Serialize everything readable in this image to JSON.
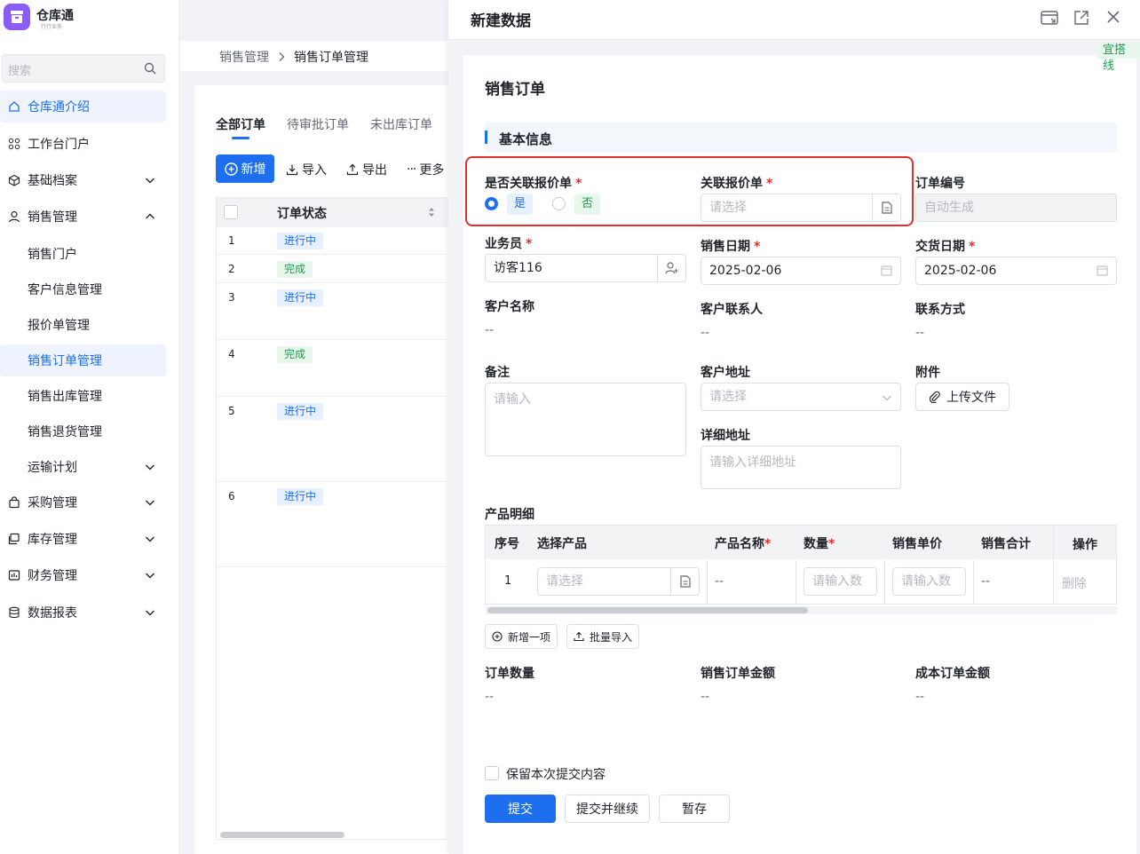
{
  "app": {
    "name": "仓库通",
    "subtitle": "行行业务"
  },
  "sidebar": {
    "search_placeholder": "搜索",
    "items": [
      {
        "label": "仓库通介绍",
        "icon": "home-icon",
        "active": true
      },
      {
        "label": "工作台门户",
        "icon": "grid-icon"
      },
      {
        "label": "基础档案",
        "icon": "cube-icon",
        "expandable": true
      },
      {
        "label": "销售管理",
        "icon": "user-icon",
        "expanded": true
      },
      {
        "label": "销售门户"
      },
      {
        "label": "客户信息管理"
      },
      {
        "label": "报价单管理"
      },
      {
        "label": "销售订单管理",
        "active": true
      },
      {
        "label": "销售出库管理"
      },
      {
        "label": "销售退货管理"
      },
      {
        "label": "运输计划",
        "expandable": true
      },
      {
        "label": "采购管理",
        "icon": "bag-icon",
        "expandable": true
      },
      {
        "label": "库存管理",
        "icon": "stack-icon",
        "expandable": true
      },
      {
        "label": "财务管理",
        "icon": "chart-icon",
        "expandable": true
      },
      {
        "label": "数据报表",
        "icon": "database-icon",
        "expandable": true
      }
    ]
  },
  "breadcrumb": {
    "parent": "销售管理",
    "current": "销售订单管理"
  },
  "list": {
    "tabs": [
      "全部订单",
      "待审批订单",
      "未出库订单"
    ],
    "toolbar": {
      "new": "新增",
      "import": "导入",
      "export": "导出",
      "more": "更多"
    },
    "column_status": "订单状态",
    "rows": [
      {
        "no": "1",
        "status": "进行中"
      },
      {
        "no": "2",
        "status": "完成"
      },
      {
        "no": "3",
        "status": "进行中"
      },
      {
        "no": "4",
        "status": "完成"
      },
      {
        "no": "5",
        "status": "进行中"
      },
      {
        "no": "6",
        "status": "进行中"
      }
    ]
  },
  "drawer": {
    "title": "新建数据",
    "tag": "宜搭线",
    "form_title": "销售订单",
    "section_basic": "基本信息",
    "fields": {
      "link_quote_label": "是否关联报价单",
      "link_quote_yes": "是",
      "link_quote_no": "否",
      "quote_label": "关联报价单",
      "quote_placeholder": "请选择",
      "order_no_label": "订单编号",
      "order_no_placeholder": "自动生成",
      "salesman_label": "业务员",
      "salesman_value": "访客116",
      "sale_date_label": "销售日期",
      "sale_date_value": "2025-02-06",
      "delivery_date_label": "交货日期",
      "delivery_date_value": "2025-02-06",
      "customer_name_label": "客户名称",
      "customer_name_value": "--",
      "customer_contact_label": "客户联系人",
      "customer_contact_value": "--",
      "contact_label": "联系方式",
      "contact_value": "--",
      "remark_label": "备注",
      "remark_placeholder": "请输入",
      "address_label": "客户地址",
      "address_placeholder": "请选择",
      "attachment_label": "附件",
      "upload_label": "上传文件",
      "detail_address_label": "详细地址",
      "detail_address_placeholder": "请输入详细地址"
    },
    "products": {
      "label": "产品明细",
      "columns": [
        "序号",
        "选择产品",
        "产品名称",
        "数量",
        "销售单价",
        "销售合计",
        "操作"
      ],
      "row": {
        "no": "1",
        "product_placeholder": "请选择",
        "name": "--",
        "qty_placeholder": "请输入数",
        "price_placeholder": "请输入数",
        "total": "--",
        "delete": "删除"
      },
      "add_item": "新增一项",
      "batch_import": "批量导入"
    },
    "summary": {
      "order_qty_label": "订单数量",
      "order_qty_value": "--",
      "sales_amount_label": "销售订单金额",
      "sales_amount_value": "--",
      "cost_amount_label": "成本订单金额",
      "cost_amount_value": "--"
    },
    "keep_content": "保留本次提交内容",
    "buttons": {
      "submit": "提交",
      "submit_continue": "提交并继续",
      "save_draft": "暂存"
    }
  },
  "colors": {
    "primary": "#1d6ff0",
    "danger": "#e0302d",
    "success": "#1a9e4a",
    "brand": "#8b5cf6"
  }
}
